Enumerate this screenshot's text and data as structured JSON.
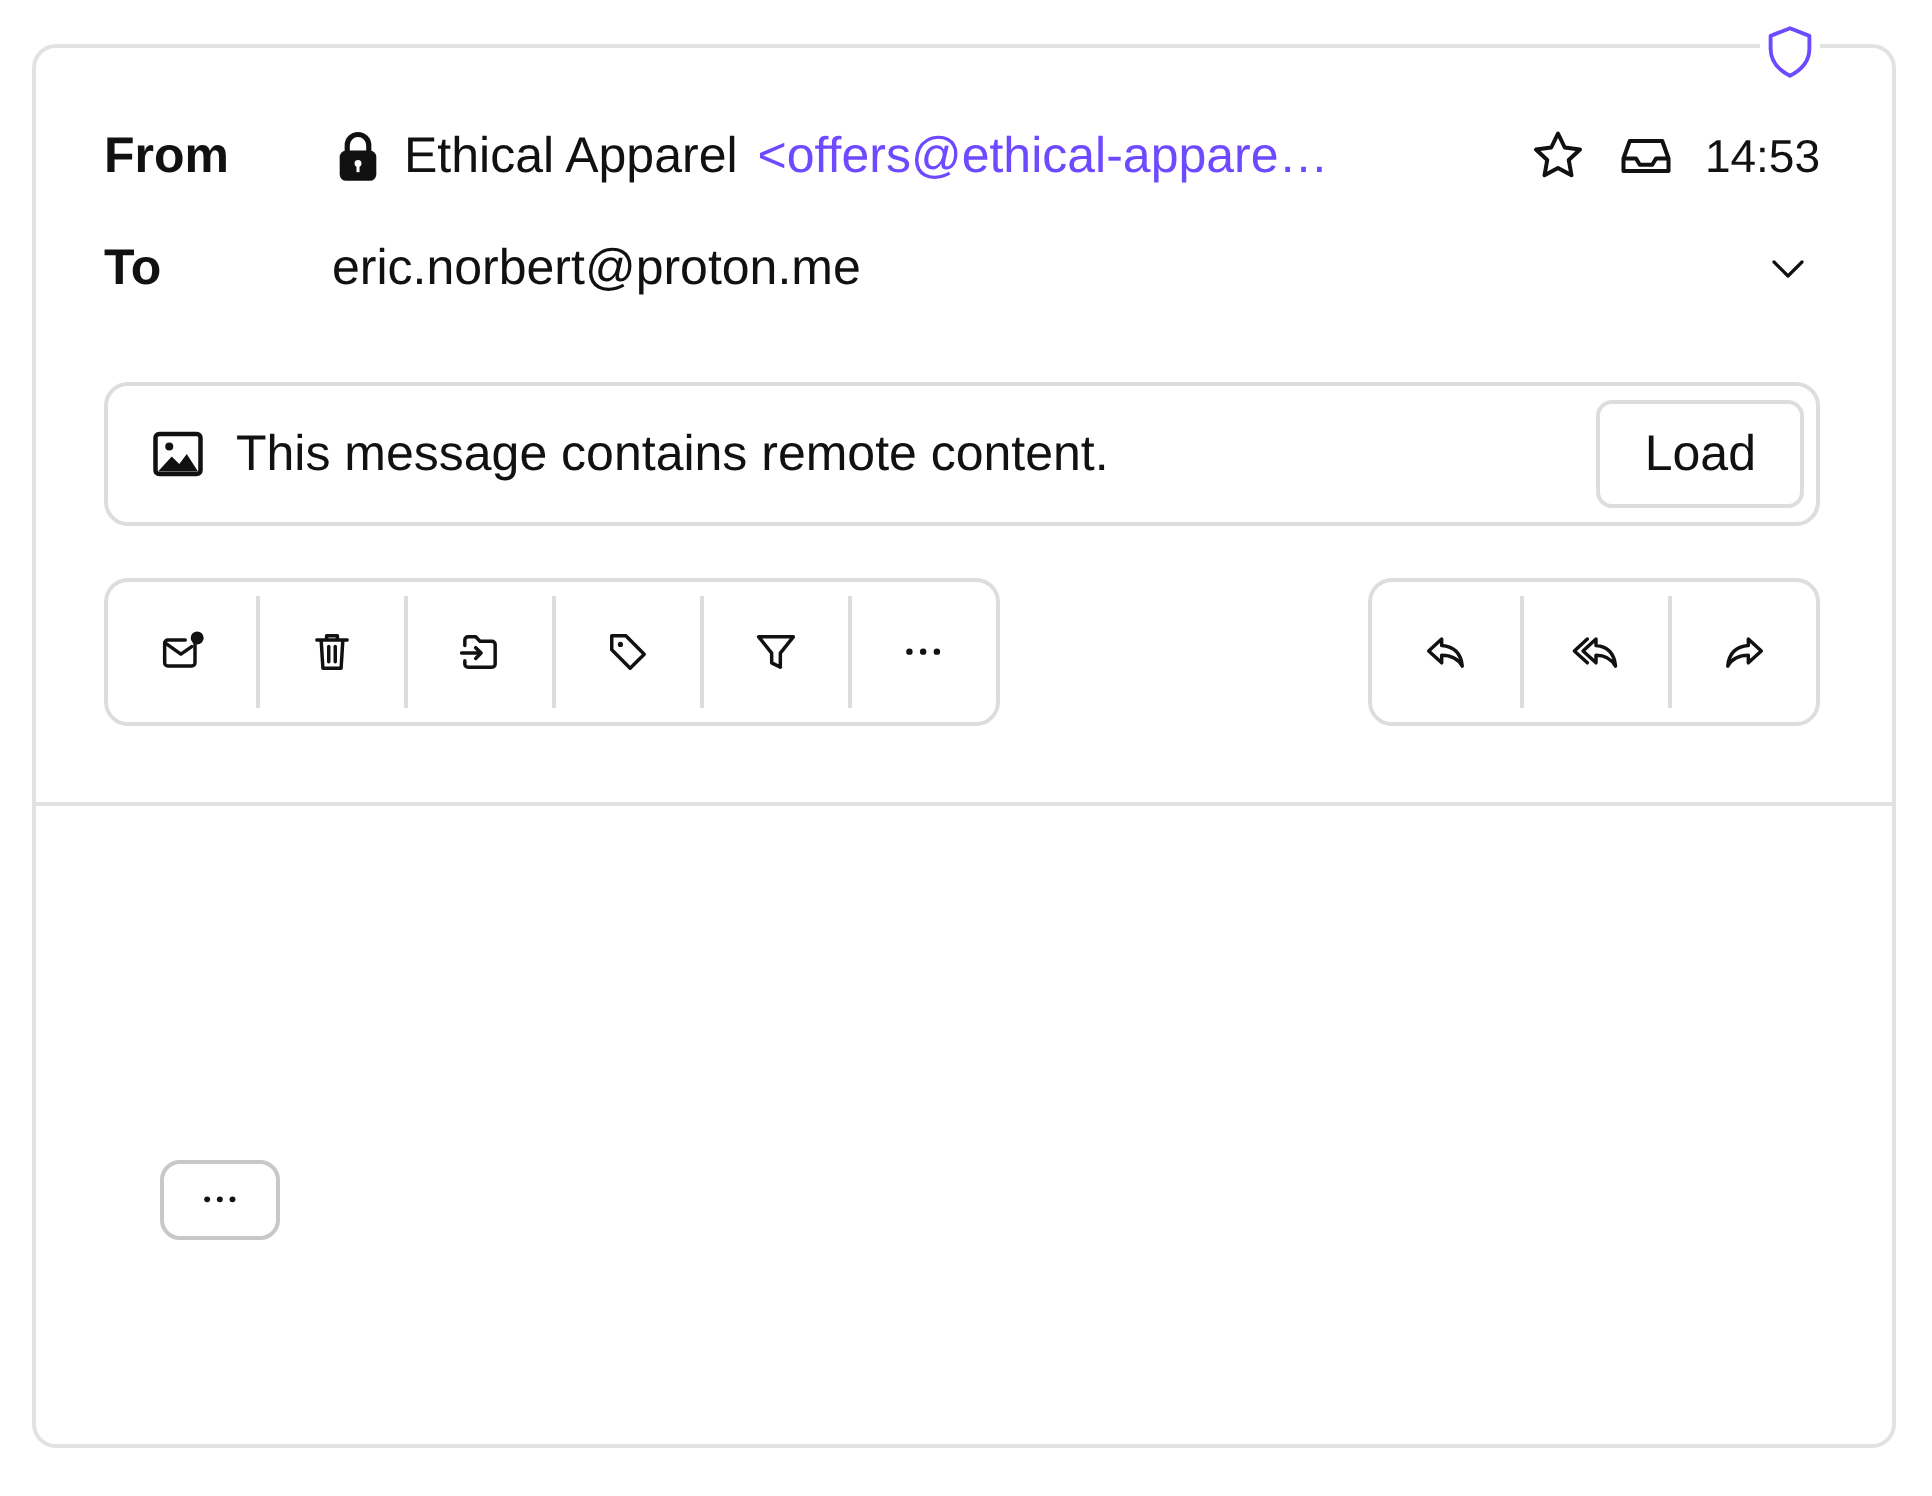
{
  "header": {
    "from_label": "From",
    "sender_name": "Ethical Apparel",
    "sender_address": "<offers@ethical-appare…",
    "time": "14:53",
    "to_label": "To",
    "recipient": "eric.norbert@proton.me"
  },
  "banner": {
    "text": "This message contains remote content.",
    "button": "Load"
  },
  "toolbar_left": [
    {
      "kind": "mark-unread"
    },
    {
      "kind": "trash"
    },
    {
      "kind": "move"
    },
    {
      "kind": "label"
    },
    {
      "kind": "filter"
    },
    {
      "kind": "more"
    }
  ],
  "toolbar_right": [
    {
      "kind": "reply"
    },
    {
      "kind": "reply-all"
    },
    {
      "kind": "forward"
    }
  ],
  "body": {
    "expand_button": {
      "kind": "more"
    }
  }
}
